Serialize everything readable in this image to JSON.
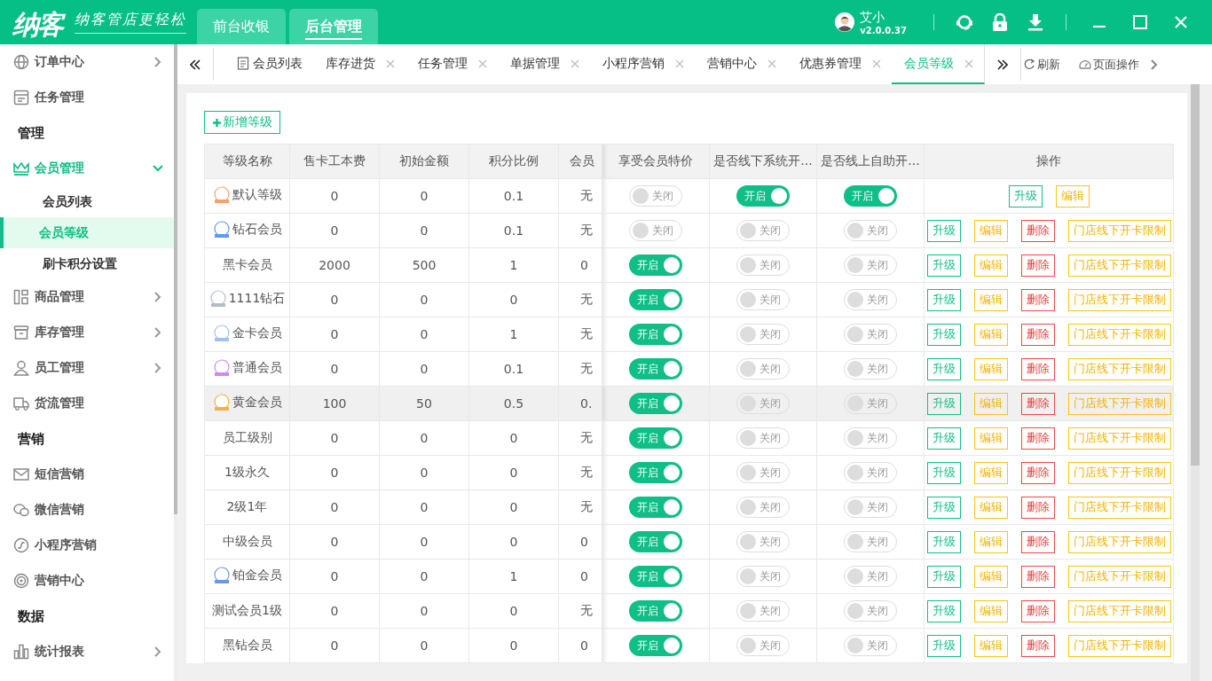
{
  "header": {
    "logo": "纳客",
    "slogan": "纳客管店更轻松",
    "nav": [
      {
        "label": "前台收银",
        "selected": false
      },
      {
        "label": "后台管理",
        "selected": true
      }
    ],
    "user": {
      "name": "艾小",
      "version": "v2.0.0.37"
    }
  },
  "sidebar": {
    "items": [
      {
        "kind": "item",
        "label": "订单中心",
        "expandable": true,
        "expanded": false,
        "active": false
      },
      {
        "kind": "item",
        "label": "任务管理",
        "expandable": false,
        "active": false
      },
      {
        "kind": "section",
        "label": "管理"
      },
      {
        "kind": "item",
        "label": "会员管理",
        "expandable": true,
        "expanded": true,
        "active": true,
        "children": [
          {
            "label": "会员列表",
            "selected": false
          },
          {
            "label": "会员等级",
            "selected": true
          },
          {
            "label": "刷卡积分设置",
            "selected": false
          }
        ]
      },
      {
        "kind": "item",
        "label": "商品管理",
        "expandable": true,
        "expanded": false,
        "active": false
      },
      {
        "kind": "item",
        "label": "库存管理",
        "expandable": true,
        "expanded": false,
        "active": false
      },
      {
        "kind": "item",
        "label": "员工管理",
        "expandable": true,
        "expanded": false,
        "active": false
      },
      {
        "kind": "item",
        "label": "货流管理",
        "expandable": false,
        "active": false
      },
      {
        "kind": "section",
        "label": "营销"
      },
      {
        "kind": "item",
        "label": "短信营销",
        "expandable": false,
        "active": false
      },
      {
        "kind": "item",
        "label": "微信营销",
        "expandable": false,
        "active": false
      },
      {
        "kind": "item",
        "label": "小程序营销",
        "expandable": false,
        "active": false
      },
      {
        "kind": "item",
        "label": "营销中心",
        "expandable": false,
        "active": false
      },
      {
        "kind": "section",
        "label": "数据"
      },
      {
        "kind": "item",
        "label": "统计报表",
        "expandable": true,
        "expanded": false,
        "active": false
      }
    ]
  },
  "tabs": [
    {
      "label": "会员列表",
      "closable": false,
      "selected": false
    },
    {
      "label": "库存进货",
      "closable": true,
      "selected": false
    },
    {
      "label": "任务管理",
      "closable": true,
      "selected": false
    },
    {
      "label": "单据管理",
      "closable": true,
      "selected": false
    },
    {
      "label": "小程序营销",
      "closable": true,
      "selected": false
    },
    {
      "label": "营销中心",
      "closable": true,
      "selected": false
    },
    {
      "label": "优惠券管理",
      "closable": true,
      "selected": false
    },
    {
      "label": "会员等级",
      "closable": true,
      "selected": true
    }
  ],
  "tab_tools": {
    "refresh": "刷新",
    "page_actions": "页面操作"
  },
  "add_button": "新增等级",
  "table": {
    "columns": [
      "等级名称",
      "售卡工本费",
      "初始金额",
      "积分比例",
      "会员",
      "享受会员特价",
      "是否线下系统开...",
      "是否线上自助开...",
      "操作"
    ],
    "rows": [
      {
        "name": "默认等级",
        "badge": {
          "color": "#f5a36a"
        },
        "card_fee": "0",
        "initial": "0",
        "ratio": "0.1",
        "column_5": "无",
        "hovered": false,
        "toggles": [
          {
            "on": false,
            "label": "关闭"
          },
          {
            "on": true,
            "label": "开启"
          },
          {
            "on": true,
            "label": "开启"
          }
        ],
        "actions": [
          {
            "kind": "upgrade",
            "label": "升级"
          },
          {
            "kind": "edit",
            "label": "编辑"
          }
        ]
      },
      {
        "name": "钻石会员",
        "badge": {
          "color": "#5b9bf0"
        },
        "card_fee": "0",
        "initial": "0",
        "ratio": "0.1",
        "column_5": "无",
        "hovered": false,
        "toggles": [
          {
            "on": false,
            "label": "关闭"
          },
          {
            "on": false,
            "label": "关闭"
          },
          {
            "on": false,
            "label": "关闭"
          }
        ],
        "actions": [
          {
            "kind": "upgrade",
            "label": "升级"
          },
          {
            "kind": "edit",
            "label": "编辑"
          },
          {
            "kind": "delete",
            "label": "删除"
          },
          {
            "kind": "limit",
            "label": "门店线下开卡限制"
          }
        ]
      },
      {
        "name": "黑卡会员",
        "card_fee": "2000",
        "initial": "500",
        "ratio": "1",
        "column_5": "0",
        "hovered": false,
        "toggles": [
          {
            "on": true,
            "label": "开启"
          },
          {
            "on": false,
            "label": "关闭"
          },
          {
            "on": false,
            "label": "关闭"
          }
        ],
        "actions": [
          {
            "kind": "upgrade",
            "label": "升级"
          },
          {
            "kind": "edit",
            "label": "编辑"
          },
          {
            "kind": "delete",
            "label": "删除"
          },
          {
            "kind": "limit",
            "label": "门店线下开卡限制"
          }
        ]
      },
      {
        "name": "1111钻石",
        "badge": {
          "color": "#b4bccc"
        },
        "card_fee": "0",
        "initial": "0",
        "ratio": "0",
        "column_5": "无",
        "hovered": false,
        "toggles": [
          {
            "on": true,
            "label": "开启"
          },
          {
            "on": false,
            "label": "关闭"
          },
          {
            "on": false,
            "label": "关闭"
          }
        ],
        "actions": [
          {
            "kind": "upgrade",
            "label": "升级"
          },
          {
            "kind": "edit",
            "label": "编辑"
          },
          {
            "kind": "delete",
            "label": "删除"
          },
          {
            "kind": "limit",
            "label": "门店线下开卡限制"
          }
        ]
      },
      {
        "name": "金卡会员",
        "badge": {
          "color": "#9ec3f0"
        },
        "card_fee": "0",
        "initial": "0",
        "ratio": "1",
        "column_5": "无",
        "hovered": false,
        "toggles": [
          {
            "on": true,
            "label": "开启"
          },
          {
            "on": false,
            "label": "关闭"
          },
          {
            "on": false,
            "label": "关闭"
          }
        ],
        "actions": [
          {
            "kind": "upgrade",
            "label": "升级"
          },
          {
            "kind": "edit",
            "label": "编辑"
          },
          {
            "kind": "delete",
            "label": "删除"
          },
          {
            "kind": "limit",
            "label": "门店线下开卡限制"
          }
        ]
      },
      {
        "name": "普通会员",
        "badge": {
          "color": "#d08af0"
        },
        "card_fee": "0",
        "initial": "0",
        "ratio": "0.1",
        "column_5": "无",
        "hovered": false,
        "toggles": [
          {
            "on": true,
            "label": "开启"
          },
          {
            "on": false,
            "label": "关闭"
          },
          {
            "on": false,
            "label": "关闭"
          }
        ],
        "actions": [
          {
            "kind": "upgrade",
            "label": "升级"
          },
          {
            "kind": "edit",
            "label": "编辑"
          },
          {
            "kind": "delete",
            "label": "删除"
          },
          {
            "kind": "limit",
            "label": "门店线下开卡限制"
          }
        ]
      },
      {
        "name": "黄金会员",
        "badge": {
          "color": "#f5b041"
        },
        "card_fee": "100",
        "initial": "50",
        "ratio": "0.5",
        "column_5": "0.",
        "hovered": true,
        "toggles": [
          {
            "on": true,
            "label": "开启"
          },
          {
            "on": false,
            "label": "关闭"
          },
          {
            "on": false,
            "label": "关闭"
          }
        ],
        "actions": [
          {
            "kind": "upgrade",
            "label": "升级"
          },
          {
            "kind": "edit",
            "label": "编辑"
          },
          {
            "kind": "delete",
            "label": "删除"
          },
          {
            "kind": "limit",
            "label": "门店线下开卡限制"
          }
        ]
      },
      {
        "name": "员工级别",
        "card_fee": "0",
        "initial": "0",
        "ratio": "0",
        "column_5": "无",
        "hovered": false,
        "toggles": [
          {
            "on": true,
            "label": "开启"
          },
          {
            "on": false,
            "label": "关闭"
          },
          {
            "on": false,
            "label": "关闭"
          }
        ],
        "actions": [
          {
            "kind": "upgrade",
            "label": "升级"
          },
          {
            "kind": "edit",
            "label": "编辑"
          },
          {
            "kind": "delete",
            "label": "删除"
          },
          {
            "kind": "limit",
            "label": "门店线下开卡限制"
          }
        ]
      },
      {
        "name": "1级永久",
        "card_fee": "0",
        "initial": "0",
        "ratio": "0",
        "column_5": "无",
        "hovered": false,
        "toggles": [
          {
            "on": true,
            "label": "开启"
          },
          {
            "on": false,
            "label": "关闭"
          },
          {
            "on": false,
            "label": "关闭"
          }
        ],
        "actions": [
          {
            "kind": "upgrade",
            "label": "升级"
          },
          {
            "kind": "edit",
            "label": "编辑"
          },
          {
            "kind": "delete",
            "label": "删除"
          },
          {
            "kind": "limit",
            "label": "门店线下开卡限制"
          }
        ]
      },
      {
        "name": "2级1年",
        "card_fee": "0",
        "initial": "0",
        "ratio": "0",
        "column_5": "无",
        "hovered": false,
        "toggles": [
          {
            "on": true,
            "label": "开启"
          },
          {
            "on": false,
            "label": "关闭"
          },
          {
            "on": false,
            "label": "关闭"
          }
        ],
        "actions": [
          {
            "kind": "upgrade",
            "label": "升级"
          },
          {
            "kind": "edit",
            "label": "编辑"
          },
          {
            "kind": "delete",
            "label": "删除"
          },
          {
            "kind": "limit",
            "label": "门店线下开卡限制"
          }
        ]
      },
      {
        "name": "中级会员",
        "card_fee": "0",
        "initial": "0",
        "ratio": "0",
        "column_5": "0",
        "hovered": false,
        "toggles": [
          {
            "on": true,
            "label": "开启"
          },
          {
            "on": false,
            "label": "关闭"
          },
          {
            "on": false,
            "label": "关闭"
          }
        ],
        "actions": [
          {
            "kind": "upgrade",
            "label": "升级"
          },
          {
            "kind": "edit",
            "label": "编辑"
          },
          {
            "kind": "delete",
            "label": "删除"
          },
          {
            "kind": "limit",
            "label": "门店线下开卡限制"
          }
        ]
      },
      {
        "name": "铂金会员",
        "badge": {
          "color": "#6a9ad8"
        },
        "card_fee": "0",
        "initial": "0",
        "ratio": "1",
        "column_5": "0",
        "hovered": false,
        "toggles": [
          {
            "on": true,
            "label": "开启"
          },
          {
            "on": false,
            "label": "关闭"
          },
          {
            "on": false,
            "label": "关闭"
          }
        ],
        "actions": [
          {
            "kind": "upgrade",
            "label": "升级"
          },
          {
            "kind": "edit",
            "label": "编辑"
          },
          {
            "kind": "delete",
            "label": "删除"
          },
          {
            "kind": "limit",
            "label": "门店线下开卡限制"
          }
        ]
      },
      {
        "name": "测试会员1级",
        "card_fee": "0",
        "initial": "0",
        "ratio": "0",
        "column_5": "无",
        "hovered": false,
        "toggles": [
          {
            "on": true,
            "label": "开启"
          },
          {
            "on": false,
            "label": "关闭"
          },
          {
            "on": false,
            "label": "关闭"
          }
        ],
        "actions": [
          {
            "kind": "upgrade",
            "label": "升级"
          },
          {
            "kind": "edit",
            "label": "编辑"
          },
          {
            "kind": "delete",
            "label": "删除"
          },
          {
            "kind": "limit",
            "label": "门店线下开卡限制"
          }
        ]
      },
      {
        "name": "黑钻会员",
        "card_fee": "0",
        "initial": "0",
        "ratio": "0",
        "column_5": "0",
        "hovered": false,
        "toggles": [
          {
            "on": true,
            "label": "开启"
          },
          {
            "on": false,
            "label": "关闭"
          },
          {
            "on": false,
            "label": "关闭"
          }
        ],
        "actions": [
          {
            "kind": "upgrade",
            "label": "升级"
          },
          {
            "kind": "edit",
            "label": "编辑"
          },
          {
            "kind": "delete",
            "label": "删除"
          },
          {
            "kind": "limit",
            "label": "门店线下开卡限制"
          }
        ]
      }
    ]
  }
}
